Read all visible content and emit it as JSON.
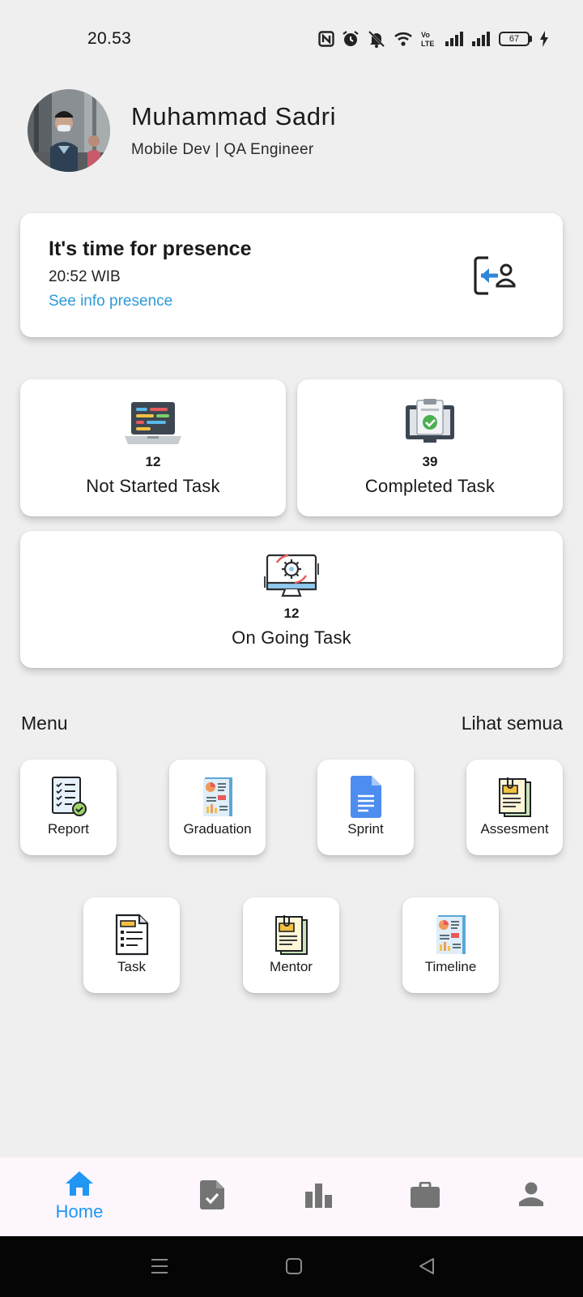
{
  "status_bar": {
    "time": "20.53",
    "battery": "67",
    "network_label": "Vo LTE"
  },
  "profile": {
    "name": "Muhammad Sadri",
    "role": "Mobile Dev | QA Engineer"
  },
  "presence": {
    "title": "It's time for presence",
    "time": "20:52 WIB",
    "link": "See info presence",
    "icon": "presence-login-icon"
  },
  "stats": [
    {
      "count": "12",
      "label": "Not Started Task",
      "icon": "laptop-code-icon"
    },
    {
      "count": "39",
      "label": "Completed Task",
      "icon": "completed-clipboard-icon"
    },
    {
      "count": "12",
      "label": "On Going Task",
      "icon": "monitor-gear-icon"
    }
  ],
  "menu": {
    "title": "Menu",
    "see_all": "Lihat semua",
    "items": [
      {
        "label": "Report",
        "icon": "report-checklist-icon"
      },
      {
        "label": "Graduation",
        "icon": "graduation-report-icon"
      },
      {
        "label": "Sprint",
        "icon": "document-icon"
      },
      {
        "label": "Assesment",
        "icon": "assessment-clip-icon"
      },
      {
        "label": "Task",
        "icon": "task-document-icon"
      },
      {
        "label": "Mentor",
        "icon": "mentor-clip-icon"
      },
      {
        "label": "Timeline",
        "icon": "timeline-chart-icon"
      }
    ]
  },
  "bottom_nav": {
    "active_label": "Home",
    "items": [
      "home-icon",
      "task-check-icon",
      "bar-chart-icon",
      "briefcase-icon",
      "person-icon"
    ]
  },
  "colors": {
    "accent": "#2196f3",
    "link": "#2e9ad8",
    "background": "#efefef",
    "card": "#ffffff"
  }
}
